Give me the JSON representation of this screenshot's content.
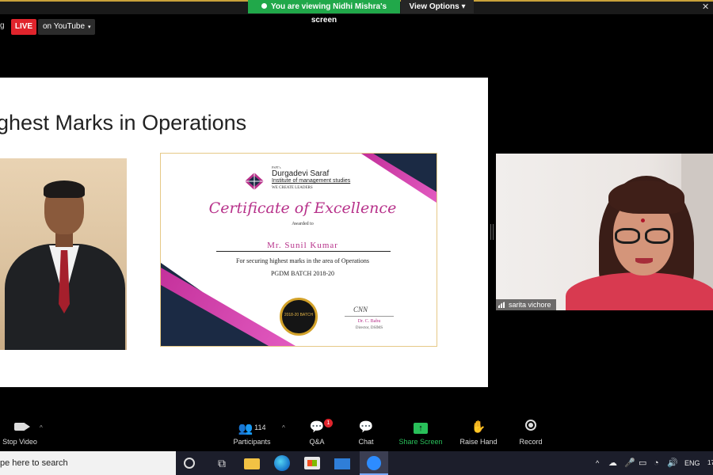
{
  "banner": {
    "viewing_text": "You are viewing Nidhi Mishra's screen",
    "view_options_label": "View Options",
    "view_options_caret": "▾",
    "close_glyph": "✕"
  },
  "live_bar": {
    "cut_text": "g",
    "live_label": "LIVE",
    "destination_label": "on YouTube",
    "caret": "▾"
  },
  "slide": {
    "title": "ghest Marks in Operations",
    "certificate": {
      "org_small": "PSPT's",
      "org_name": "Durgadevi Saraf",
      "institute": "Institute of management studies",
      "tagline": "WE CREATE LEADERS",
      "title": "Certificate of Excellence",
      "awarded_to": "Awarded to",
      "recipient": "Mr. Sunil Kumar",
      "reason": "For securing highest marks in the area of Operations",
      "batch": "PGDM BATCH 2018-20",
      "seal_text": "2018-20 BATCH",
      "signature_scribble": "CNN",
      "signatory_name": "Dr. C. Babu",
      "signatory_role": "Director, DSIMS"
    }
  },
  "participant_tile": {
    "name": "sarita vichore"
  },
  "toolbar": {
    "stop_video_label": "Stop Video",
    "participants_label": "Participants",
    "participants_count": "114",
    "qa_label": "Q&A",
    "qa_badge": "1",
    "chat_label": "Chat",
    "share_screen_label": "Share Screen",
    "share_icon_glyph": "↑",
    "raise_hand_label": "Raise Hand",
    "record_label": "Record",
    "caret_up": "^",
    "icons": {
      "participants": "👥",
      "qa": "💬",
      "chat": "💬",
      "raise_hand": "✋"
    }
  },
  "taskbar": {
    "search_placeholder": "pe here to search",
    "taskview_glyph": "⧉",
    "tray_caret": "^",
    "tray_cloud": "☁",
    "tray_mic": "🎤",
    "tray_battery": "▭",
    "tray_wifi": "◔",
    "tray_volume": "🔊",
    "language": "ENG",
    "time_cut": "17"
  },
  "colors": {
    "share_green": "#29c05a",
    "banner_green": "#21a84a",
    "live_red": "#e0242c",
    "certificate_magenta": "#b7318a",
    "certificate_navy": "#1b2a44"
  }
}
